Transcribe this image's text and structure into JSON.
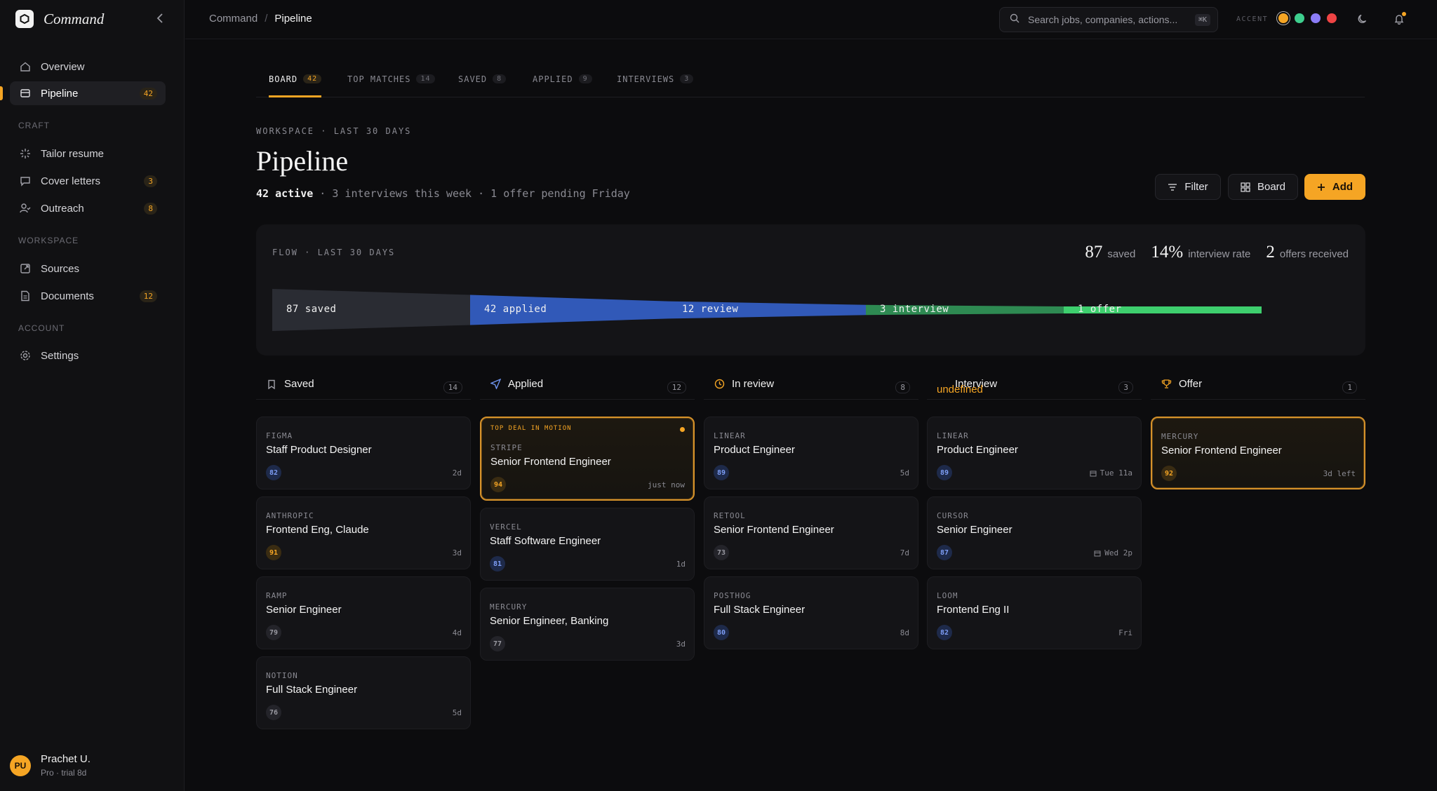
{
  "app": {
    "name": "Command"
  },
  "sidebar": {
    "items_main": [
      {
        "label": "Overview",
        "icon": "home-icon"
      },
      {
        "label": "Pipeline",
        "icon": "board-icon",
        "badge": "42",
        "active": true
      }
    ],
    "sections": [
      {
        "title": "CRAFT",
        "items": [
          {
            "label": "Tailor resume",
            "icon": "sparkle-icon"
          },
          {
            "label": "Cover letters",
            "icon": "message-icon",
            "badge": "3"
          },
          {
            "label": "Outreach",
            "icon": "user-check-icon",
            "badge": "8"
          }
        ]
      },
      {
        "title": "WORKSPACE",
        "items": [
          {
            "label": "Sources",
            "icon": "external-link-icon"
          },
          {
            "label": "Documents",
            "icon": "document-icon",
            "badge": "12"
          }
        ]
      },
      {
        "title": "ACCOUNT",
        "items": [
          {
            "label": "Settings",
            "icon": "gear-icon"
          }
        ]
      }
    ],
    "user": {
      "initials": "PU",
      "name": "Prachet U.",
      "plan": "Pro · trial 8d"
    }
  },
  "topbar": {
    "breadcrumb": [
      "Command",
      "Pipeline"
    ],
    "search_placeholder": "Search jobs, companies, actions...",
    "search_kbd": "⌘K",
    "accent_label": "ACCENT",
    "accent_colors": [
      "#f5a524",
      "#3ecf8e",
      "#8b7cf6",
      "#ef4444"
    ]
  },
  "tabs": [
    {
      "label": "BOARD",
      "count": "42",
      "active": true
    },
    {
      "label": "TOP MATCHES",
      "count": "14"
    },
    {
      "label": "SAVED",
      "count": "8"
    },
    {
      "label": "APPLIED",
      "count": "9"
    },
    {
      "label": "INTERVIEWS",
      "count": "3"
    }
  ],
  "header": {
    "eyebrow": "WORKSPACE · LAST 30 DAYS",
    "title": "Pipeline",
    "subtitle_strong": "42 active",
    "subtitle_rest": " · 3 interviews this week · 1 offer pending Friday",
    "filter_label": "Filter",
    "board_label": "Board",
    "add_label": "Add"
  },
  "flow": {
    "title": "FLOW · LAST 30 DAYS",
    "stats": [
      {
        "num": "87",
        "label": "saved"
      },
      {
        "num": "14%",
        "label": "interview rate"
      },
      {
        "num": "2",
        "label": "offers received"
      }
    ],
    "stages": [
      {
        "label": "87 saved",
        "count": 87,
        "color": "#2a2c33"
      },
      {
        "label": "42 applied",
        "count": 42,
        "color": "#3159b8"
      },
      {
        "label": "12 review",
        "count": 12,
        "color": "#3159b8"
      },
      {
        "label": "3 interview",
        "count": 3,
        "color": "#2e8a52"
      },
      {
        "label": "1 offer",
        "count": 1,
        "color": "#3ecf6e"
      }
    ]
  },
  "columns": [
    {
      "name": "Saved",
      "count": "14",
      "icon": "bookmark-icon",
      "cards": [
        {
          "company": "FIGMA",
          "role": "Staff Product Designer",
          "score": "82",
          "tone": "blue",
          "meta": "2d"
        },
        {
          "company": "ANTHROPIC",
          "role": "Frontend Eng, Claude",
          "score": "91",
          "tone": "amber",
          "meta": "3d"
        },
        {
          "company": "RAMP",
          "role": "Senior Engineer",
          "score": "79",
          "tone": "gray",
          "meta": "4d"
        },
        {
          "company": "NOTION",
          "role": "Full Stack Engineer",
          "score": "76",
          "tone": "gray",
          "meta": "5d"
        }
      ]
    },
    {
      "name": "Applied",
      "count": "12",
      "icon": "send-icon",
      "cards": [
        {
          "tag": "TOP DEAL IN MOTION",
          "company": "STRIPE",
          "role": "Senior Frontend Engineer",
          "score": "94",
          "tone": "amber",
          "meta": "just now",
          "highlight": true
        },
        {
          "company": "VERCEL",
          "role": "Staff Software Engineer",
          "score": "81",
          "tone": "blue",
          "meta": "1d"
        },
        {
          "company": "MERCURY",
          "role": "Senior Engineer, Banking",
          "score": "77",
          "tone": "gray",
          "meta": "3d"
        }
      ]
    },
    {
      "name": "In review",
      "count": "8",
      "icon": "clock-icon",
      "cards": [
        {
          "company": "LINEAR",
          "role": "Product Engineer",
          "score": "89",
          "tone": "blue",
          "meta": "5d"
        },
        {
          "company": "RETOOL",
          "role": "Senior Frontend Engineer",
          "score": "73",
          "tone": "gray",
          "meta": "7d"
        },
        {
          "company": "POSTHOG",
          "role": "Full Stack Engineer",
          "score": "80",
          "tone": "blue",
          "meta": "8d"
        }
      ]
    },
    {
      "name": "Interview",
      "count": "3",
      "icon": "undefined",
      "ghost": "undefined",
      "cards": [
        {
          "company": "LINEAR",
          "role": "Product Engineer",
          "score": "89",
          "tone": "blue",
          "meta": "Tue 11a",
          "calendar": true
        },
        {
          "company": "CURSOR",
          "role": "Senior Engineer",
          "score": "87",
          "tone": "blue",
          "meta": "Wed 2p",
          "calendar": true
        },
        {
          "company": "LOOM",
          "role": "Frontend Eng II",
          "score": "82",
          "tone": "blue",
          "meta": "Fri"
        }
      ]
    },
    {
      "name": "Offer",
      "count": "1",
      "icon": "trophy-icon",
      "cards": [
        {
          "company": "MERCURY",
          "role": "Senior Frontend Engineer",
          "score": "92",
          "tone": "amber",
          "meta": "3d left",
          "highlight": true
        }
      ]
    }
  ]
}
